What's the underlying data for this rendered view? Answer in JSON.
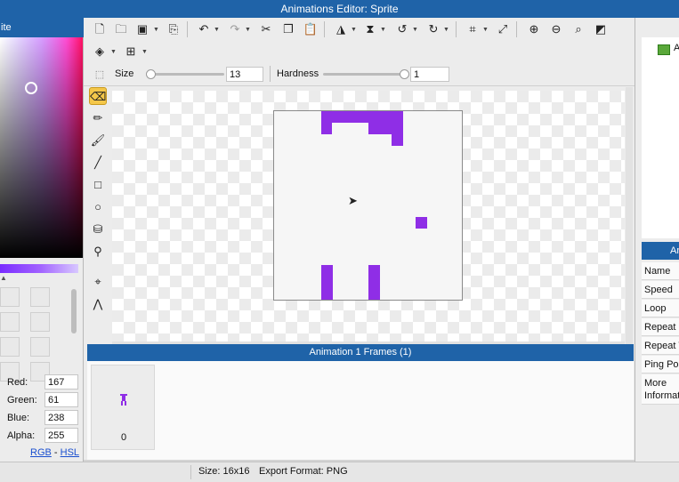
{
  "window": {
    "title": "Animations Editor: Sprite"
  },
  "left_panel": {
    "header": "ite",
    "selected_color": "#a73dee",
    "rgb": [
      {
        "label": "Red:",
        "value": "167"
      },
      {
        "label": "Green:",
        "value": "61"
      },
      {
        "label": "Blue:",
        "value": "238"
      },
      {
        "label": "Alpha:",
        "value": "255"
      }
    ],
    "link_rgb": "RGB",
    "link_sep": "-",
    "link_hsl": "HSL"
  },
  "toolbar": {
    "row1_icons": [
      "new-icon",
      "open-icon",
      "save-icon",
      "save-as-icon",
      "undo-icon",
      "redo-icon",
      "cut-icon",
      "copy-icon",
      "paste-icon",
      "flip-horizontal-icon",
      "flip-vertical-icon",
      "rotate-ccw-icon",
      "rotate-cw-icon",
      "crop-icon",
      "resize-icon",
      "zoom-in-icon",
      "zoom-out-icon",
      "zoom-fit-icon",
      "fill-toggle-icon"
    ],
    "row2_icons": [
      "layers-icon",
      "grid-icon"
    ]
  },
  "brush": {
    "size_label": "Size",
    "size_value": "13",
    "hardness_label": "Hardness",
    "hardness_value": "1"
  },
  "tools": [
    "eraser-icon",
    "pencil-icon",
    "brush-icon",
    "line-icon",
    "rectangle-icon",
    "ellipse-icon",
    "fill-bucket-icon",
    "eyedropper-icon",
    "select-point-icon",
    "node-edit-icon"
  ],
  "frames": {
    "header": "Animation 1 Frames (1)",
    "items": [
      {
        "number": "0"
      }
    ]
  },
  "right_panel": {
    "item_label": "A",
    "properties_header": "An",
    "properties": [
      "Name",
      "Speed",
      "Loop",
      "Repeat C",
      "Repeat T",
      "Ping Pon",
      "More Informat"
    ]
  },
  "status": {
    "size": "Size: 16x16",
    "export": "Export Format: PNG"
  },
  "colors": {
    "accent": "#1f63a8",
    "sprite_purple": "#8f2ee6",
    "active_tool": "#f4c74a"
  }
}
